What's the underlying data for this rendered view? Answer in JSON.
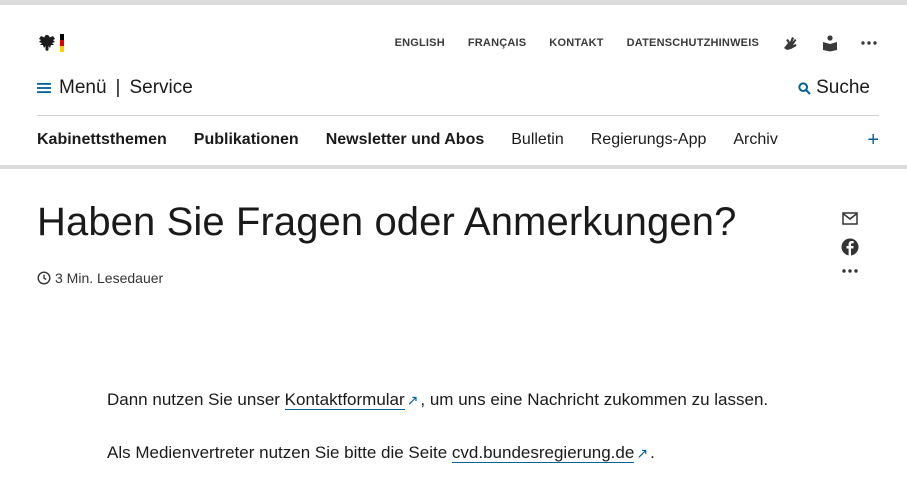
{
  "header": {
    "utility_links": [
      "ENGLISH",
      "FRANÇAIS",
      "KONTAKT",
      "DATENSCHUTZHINWEIS"
    ],
    "utility_icons": [
      "sign-language-icon",
      "easy-language-icon",
      "more-icon"
    ],
    "menu_label": "Menü",
    "separator": "|",
    "service_label": "Service",
    "search_label": "Suche"
  },
  "nav": {
    "items": [
      {
        "label": "Kabinettsthemen",
        "bold": true
      },
      {
        "label": "Publikationen",
        "bold": true
      },
      {
        "label": "Newsletter und Abos",
        "bold": true
      },
      {
        "label": "Bulletin",
        "bold": false
      },
      {
        "label": "Regierungs-App",
        "bold": false
      },
      {
        "label": "Archiv",
        "bold": false
      }
    ],
    "expand_label": "+"
  },
  "main": {
    "title": "Haben Sie Fragen oder Anmerkungen?",
    "read_time": "3 Min. Lesedauer",
    "paragraph1": {
      "before": "Dann nutzen Sie unser ",
      "link": "Kontaktformular",
      "after": ", um uns eine Nachricht zukommen zu lassen."
    },
    "paragraph2": {
      "before": "Als Medienvertreter nutzen Sie bitte die Seite ",
      "link": "cvd.bundesregierung.de",
      "after": "."
    },
    "external_marker": "↗"
  },
  "share": {
    "icons": [
      "mail-icon",
      "facebook-icon",
      "more-icon"
    ]
  },
  "colors": {
    "accent": "#00629a",
    "text": "#1a1a1a",
    "rule": "#dcdcdc"
  }
}
